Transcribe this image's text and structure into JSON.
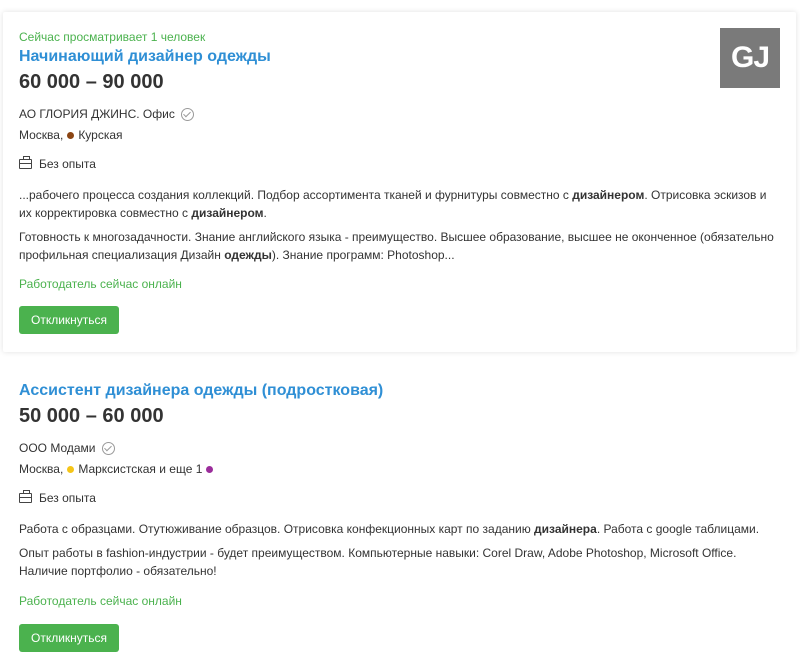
{
  "vacancies": [
    {
      "viewing": "Сейчас просматривает 1 человек",
      "title": "Начинающий дизайнер одежды",
      "salary": "60 000 – 90 000 ",
      "company": "АО ГЛОРИЯ ДЖИНС. Офис",
      "city": "Москва,",
      "metro": "Курская",
      "metro_color": "#8b4513",
      "experience": "Без опыта",
      "logo": "GJ",
      "desc1": {
        "p1": "...рабочего процесса создания коллекций. Подбор ассортимента тканей и фурнитуры совместно с ",
        "b1": "дизайнером",
        "p2": ". Отрисовка эскизов и их корректировка совместно с ",
        "b2": "дизайнером",
        "p3": "."
      },
      "desc2": {
        "p1": "Готовность к многозадачности. Знание английского языка - преимущество. Высшее образование, высшее не оконченное (обязательно профильная специализация Дизайн ",
        "b1": "одежды",
        "p2": "). Знание программ: Photoshop..."
      },
      "online": "Работодатель сейчас онлайн",
      "button": "Откликнуться"
    },
    {
      "title": "Ассистент дизайнера одежды (подростковая)",
      "salary": "50 000 – 60 000 ",
      "company": "ООО Модами",
      "city": "Москва,",
      "metro": "Марксистская и еще 1",
      "metro_color": "#f5c518",
      "metro_color2": "#9b2d9b",
      "experience": "Без опыта",
      "desc1": {
        "p1": "Работа с образцами. Отутюживание образцов. Отрисовка конфекционных карт по заданию ",
        "b1": "дизайнера",
        "p2": ". Работа с google таблицами."
      },
      "desc2": {
        "p1": "Опыт работы в fashion-индустрии - будет преимуществом. Компьютерные навыки: Corel Draw, Adobe Photoshop, Microsoft Office. Наличие портфолио - обязательно!"
      },
      "online": "Работодатель сейчас онлайн",
      "button": "Откликнуться"
    }
  ]
}
